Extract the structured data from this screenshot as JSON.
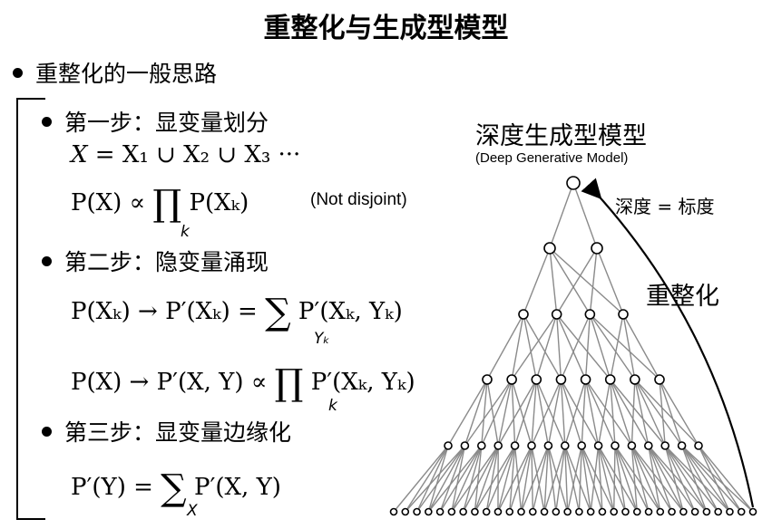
{
  "title": "重整化与生成型模型",
  "bullet": "重整化的一般思路",
  "steps": {
    "s1": "第一步：显变量划分",
    "s2": "第二步：隐变量涌现",
    "s3": "第三步：显变量边缘化"
  },
  "formulas": {
    "f1_lhs": "X",
    "f1_rhs": "= X₁ ∪ X₂ ∪ X₃ ···",
    "f2_lhs": "P(X) ∝",
    "f2_op": "∏",
    "f2_sub": "k",
    "f2_rhs": "P(Xₖ)",
    "f2_note": "(Not disjoint)",
    "f3_lhs": "P(Xₖ) → P′(Xₖ) =",
    "f3_op": "∑",
    "f3_sub": "Yₖ",
    "f3_rhs": "P′(Xₖ, Yₖ)",
    "f4_lhs": "P(X) → P′(X, Y) ∝",
    "f4_op": "∏",
    "f4_sub": "k",
    "f4_rhs": "P′(Xₖ, Yₖ)",
    "f5_lhs": "P′(Y) =",
    "f5_op": "∑",
    "f5_sub": "X",
    "f5_rhs": "P′(X, Y)"
  },
  "diagram": {
    "title": "深度生成型模型",
    "subtitle": "(Deep Generative Model)",
    "depth_label": "深度 = 标度",
    "renorm_label": "重整化",
    "layers": [
      1,
      2,
      4,
      8,
      16,
      32
    ],
    "node_color": "#000000",
    "edge_color": "#8a8a8a"
  }
}
